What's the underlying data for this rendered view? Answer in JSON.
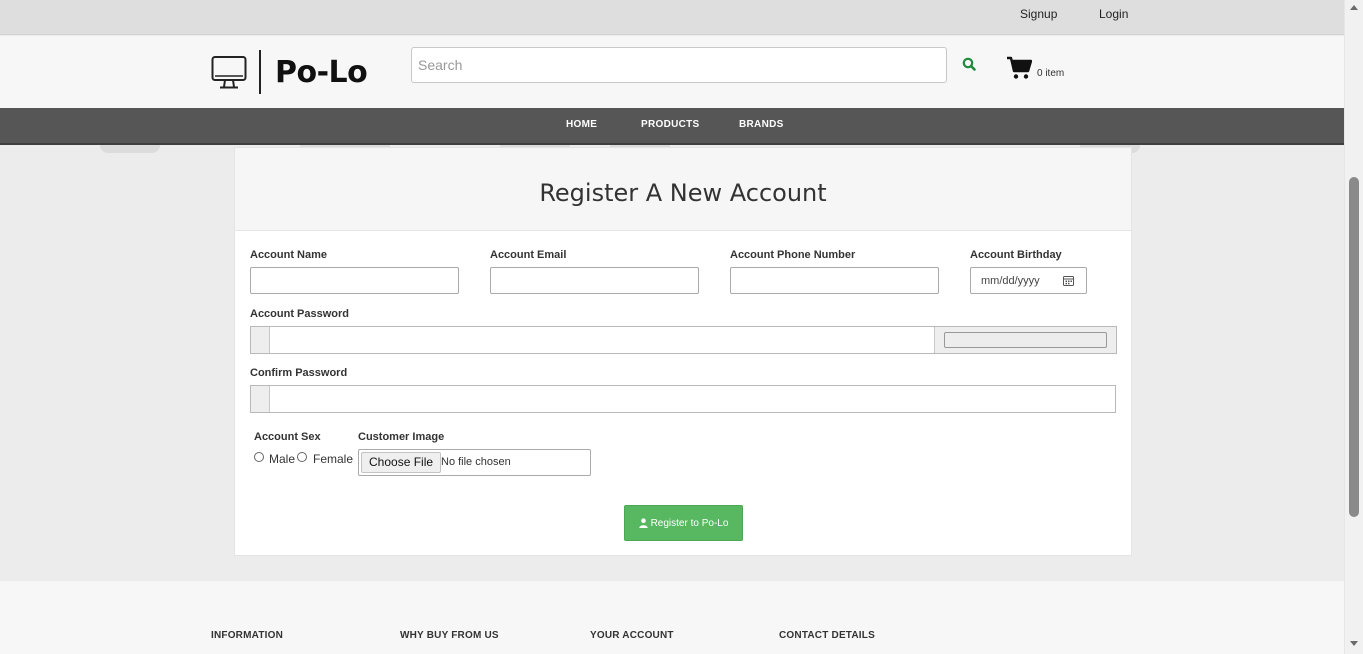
{
  "topbar": {
    "signup": "Signup",
    "login": "Login"
  },
  "header": {
    "logo_text": "Po-Lo",
    "search_placeholder": "Search",
    "cart_count": "0 item"
  },
  "nav": {
    "items": [
      "HOME",
      "PRODUCTS",
      "BRANDS"
    ]
  },
  "form": {
    "title": "Register A New Account",
    "account_name_label": "Account Name",
    "account_email_label": "Account Email",
    "account_phone_label": "Account Phone Number",
    "account_birthday_label": "Account Birthday",
    "birthday_placeholder": "mm/dd/yyyy",
    "account_password_label": "Account Password",
    "confirm_password_label": "Confirm Password",
    "account_sex_label": "Account Sex",
    "sex_options": [
      "Male",
      "Female"
    ],
    "customer_image_label": "Customer Image",
    "file_button": "Choose File",
    "file_status": "No file chosen",
    "submit_label": "Register to Po-Lo"
  },
  "footer": {
    "headings": [
      "INFORMATION",
      "WHY BUY FROM US",
      "YOUR ACCOUNT",
      "CONTACT DETAILS"
    ]
  },
  "colors": {
    "nav_bg": "#565656",
    "submit_bg": "#58b861",
    "search_icon": "#1e8a3c"
  },
  "icons": [
    "monitor-icon",
    "search-icon",
    "cart-icon",
    "calendar-icon",
    "user-icon"
  ]
}
